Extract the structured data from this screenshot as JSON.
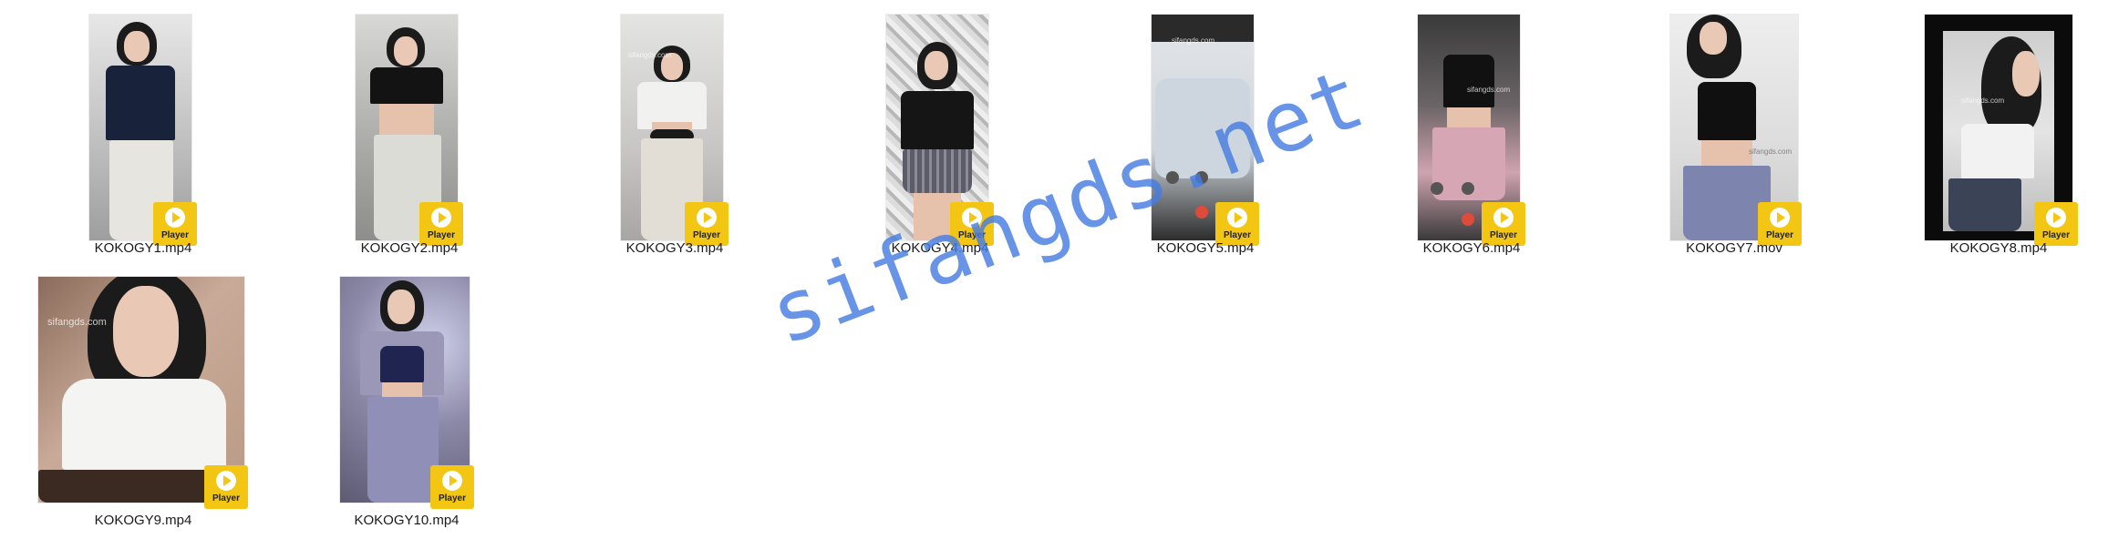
{
  "files": [
    {
      "name": "KOKOGY1.mp4",
      "badge": "Player",
      "scene_bg": "#b9b9b9",
      "top_color": "#18223a",
      "pants_color": "#e7e5df"
    },
    {
      "name": "KOKOGY2.mp4",
      "badge": "Player",
      "scene_bg": "#a9a9a7",
      "top_color": "#131313",
      "pants_color": "#dcdcd6"
    },
    {
      "name": "KOKOGY3.mp4",
      "badge": "Player",
      "scene_bg": "#c7c6c4",
      "top_color": "#f1f1ef",
      "pants_color": "#e2ded5"
    },
    {
      "name": "KOKOGY4.mp4",
      "badge": "Player",
      "scene_bg": "#c9c9c9",
      "top_color": "#151515",
      "pants_color": "#5c5c68"
    },
    {
      "name": "KOKOGY5.mp4",
      "badge": "Player",
      "scene_bg": "#dfe3e6",
      "top_color": "#cdd6de",
      "pants_color": "#2a2a2a"
    },
    {
      "name": "KOKOGY6.mp4",
      "badge": "Player",
      "scene_bg": "#5e5a5c",
      "top_color": "#111111",
      "pants_color": "#d6a6b4"
    },
    {
      "name": "KOKOGY7.mov",
      "badge": "Player",
      "scene_bg": "#dcdcdc",
      "top_color": "#101010",
      "pants_color": "#7d84ad"
    },
    {
      "name": "KOKOGY8.mp4",
      "badge": "Player",
      "scene_bg": "#0b0b0b",
      "top_color": "#f2f2f2",
      "pants_color": "#3b4356"
    },
    {
      "name": "KOKOGY9.mp4",
      "badge": "Player",
      "scene_bg": "#b99a86",
      "top_color": "#f4f4f2",
      "pants_color": "#3a2a22"
    },
    {
      "name": "KOKOGY10.mp4",
      "badge": "Player",
      "scene_bg": "#7d7a96",
      "top_color": "#1f2550",
      "pants_color": "#8f8fb8"
    }
  ],
  "thumb_watermarks": [
    "sifangds.com",
    "sifangds.com",
    "sifangds.com",
    "sifangds.com",
    "sifangds.com"
  ],
  "overlay_watermark": "sifangds.net",
  "colors": {
    "badge": "#f3c614",
    "watermark": "#4a7de0",
    "background": "#ffffff"
  }
}
